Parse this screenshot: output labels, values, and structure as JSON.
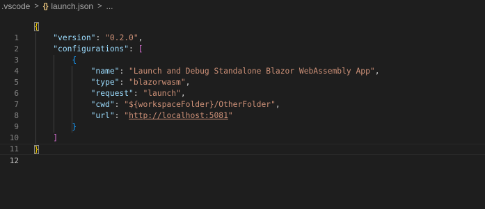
{
  "breadcrumb": {
    "folder": ".vscode",
    "file": "launch.json",
    "more": "...",
    "json_icon": "{}"
  },
  "editor": {
    "line_numbers": [
      "1",
      "2",
      "3",
      "4",
      "5",
      "6",
      "7",
      "8",
      "9",
      "10",
      "11",
      "12"
    ],
    "current_line": "12",
    "open_brace": "{",
    "close_brace": "}",
    "version_key": "\"version\"",
    "version_value": "\"0.2.0\"",
    "configurations_key": "\"configurations\"",
    "array_open": "[",
    "array_close": "]",
    "obj_open": "{",
    "obj_close": "}",
    "name_key": "\"name\"",
    "name_value": "\"Launch and Debug Standalone Blazor WebAssembly App\"",
    "type_key": "\"type\"",
    "type_value": "\"blazorwasm\"",
    "request_key": "\"request\"",
    "request_value": "\"launch\"",
    "cwd_key": "\"cwd\"",
    "cwd_value": "\"${workspaceFolder}/OtherFolder\"",
    "url_key": "\"url\"",
    "url_value_quote_open": "\"",
    "url_value": "http://localhost:5081",
    "url_value_quote_close": "\""
  },
  "colors": {
    "background": "#1e1e1e",
    "key": "#9cdcfe",
    "string": "#ce9178",
    "brace_level1": "#ffd700",
    "brace_level2": "#da70d6",
    "brace_level3": "#179fff"
  }
}
